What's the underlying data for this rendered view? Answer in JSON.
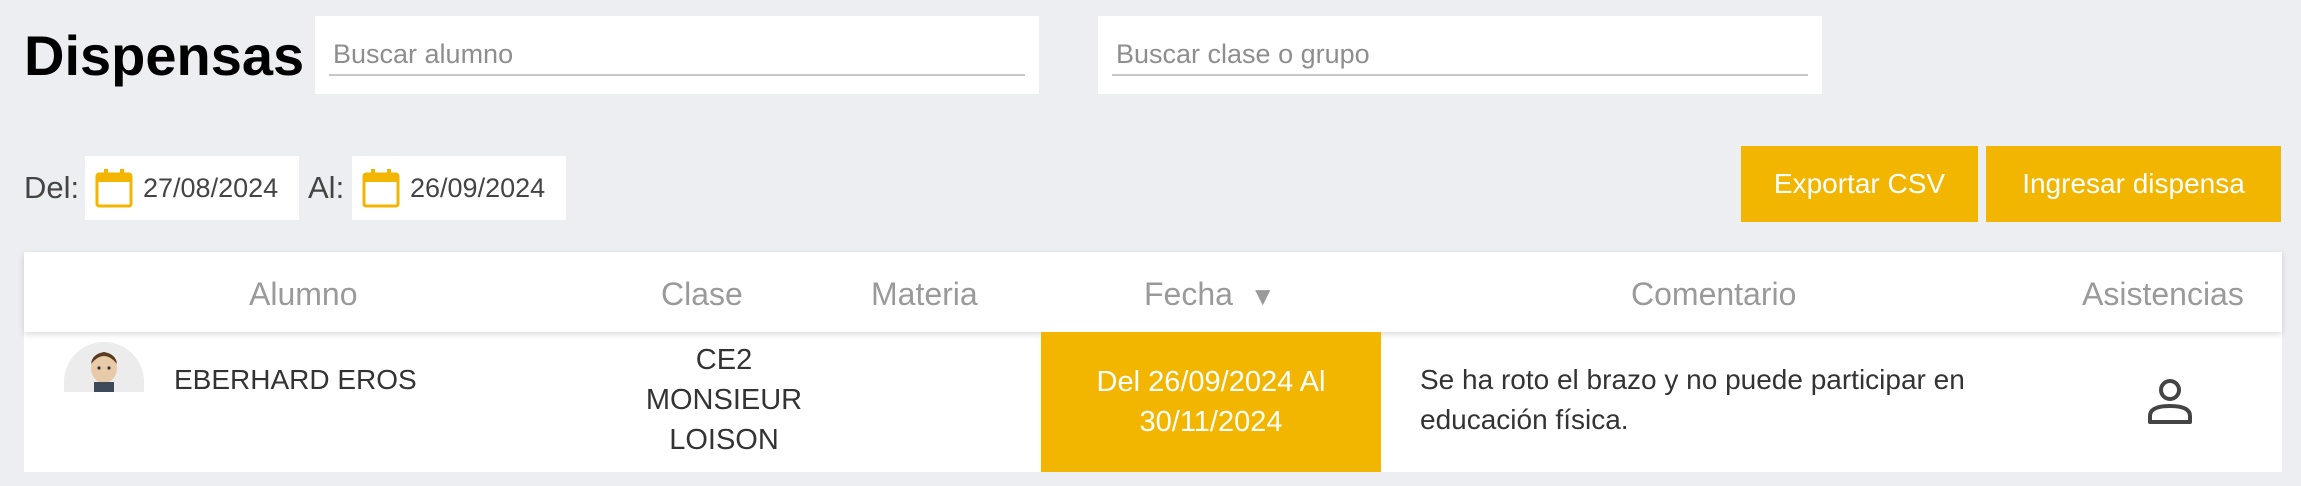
{
  "header": {
    "title": "Dispensas",
    "search_student_placeholder": "Buscar alumno",
    "search_class_placeholder": "Buscar clase o grupo"
  },
  "filters": {
    "from_label": "Del:",
    "from_date": "27/08/2024",
    "to_label": "Al:",
    "to_date": "26/09/2024"
  },
  "actions": {
    "export_label": "Exportar CSV",
    "add_label": "Ingresar dispensa"
  },
  "table": {
    "columns": [
      "Alumno",
      "Clase",
      "Materia",
      "Fecha",
      "Comentario",
      "Asistencias"
    ],
    "sort_indicator": "▼",
    "rows": [
      {
        "student": "EBERHARD EROS",
        "class_lines": [
          "CE2",
          "MONSIEUR",
          "LOISON"
        ],
        "subject": "",
        "date_line1": "Del 26/09/2024 Al",
        "date_line2": "30/11/2024",
        "comment_line1": "Se ha roto el brazo y no puede participar en",
        "comment_line2": "educación física."
      }
    ]
  },
  "colors": {
    "accent": "#f2b600",
    "background": "#edeef2",
    "header_text": "#9a9a9a"
  },
  "icons": {
    "calendar": "calendar-icon",
    "sort": "sort-desc-icon",
    "attendance": "person-icon"
  }
}
